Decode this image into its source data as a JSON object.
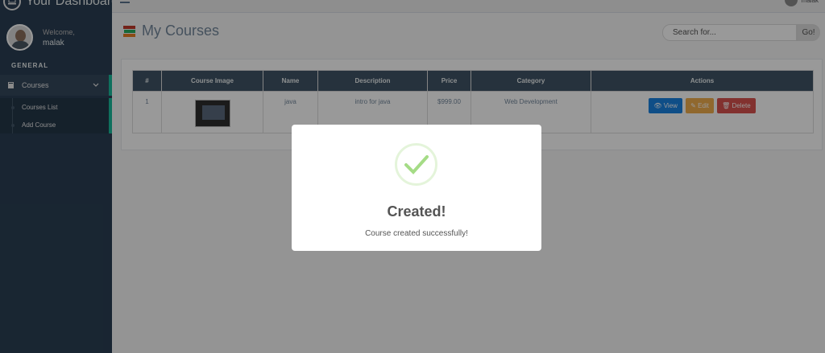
{
  "brand": {
    "title": "Your Dashboard",
    "icon": "laptop-icon"
  },
  "profile": {
    "welcome": "Welcome,",
    "name": "malak"
  },
  "sidebar": {
    "section": "GENERAL",
    "courses_label": "Courses",
    "children": [
      {
        "label": "Courses List"
      },
      {
        "label": "Add Course"
      }
    ]
  },
  "topbar": {
    "user": "malak"
  },
  "main": {
    "title": "My Courses",
    "icon": "books-icon"
  },
  "search": {
    "placeholder": "Search for...",
    "button": "Go!"
  },
  "table": {
    "headers": [
      "#",
      "Course Image",
      "Name",
      "Description",
      "Price",
      "Category",
      "Actions"
    ],
    "rows": [
      {
        "num": "1",
        "name": "java",
        "description": "intro for java",
        "price": "$999.00",
        "category": "Web Development"
      }
    ],
    "actions": {
      "view": "View",
      "edit": "Edit",
      "delete": "Delete"
    }
  },
  "modal": {
    "title": "Created!",
    "text": "Course created successfully!",
    "icon": "checkmark-icon"
  },
  "colors": {
    "sidebar": "#2a3f54",
    "accent": "#1abb9c",
    "view": "#1a82e2",
    "edit": "#f0ad4e",
    "delete": "#d9534f",
    "success": "#a5dc86"
  }
}
